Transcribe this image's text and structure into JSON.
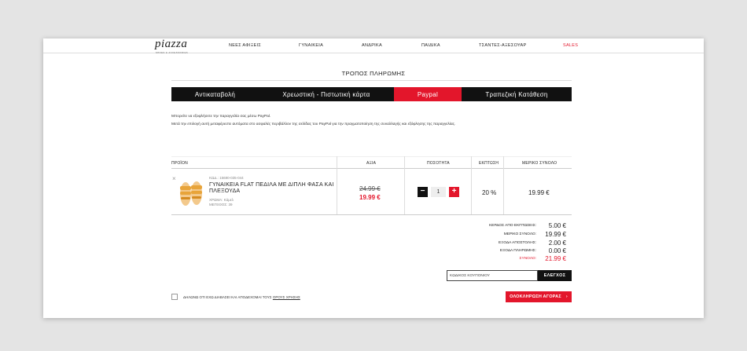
{
  "header": {
    "logo": "piazza",
    "logo_tagline": "SHOES & ACCESSORIES",
    "nav": [
      "ΝΕΕΣ ΑΦΙΞΕΙΣ",
      "ΓΥΝΑΙΚΕΙΑ",
      "ΑΝΔΡΙΚΑ",
      "ΠΑΙΔΙΚΑ",
      "ΤΣΑΝΤΕΣ-ΑΞΕΣΟΥΑΡ",
      "SALES"
    ]
  },
  "page_title": "ΤΡΟΠΟΣ ΠΛΗΡΩΜΗΣ",
  "payment_tabs": [
    {
      "label": "Αντικαταβολή",
      "active": false
    },
    {
      "label": "Χρεωστική - Πιστωτική κάρτα",
      "active": false
    },
    {
      "label": "Paypal",
      "active": true
    },
    {
      "label": "Τραπεζική Κατάθεση",
      "active": false
    }
  ],
  "info": {
    "line1": "Μπορείτε να εξοφλήσετε την παραγγελία σας μέσω PayPal.",
    "line2": "Μετά την επιλογή αυτή μεταφέρεστε αυτόματα στο ασφαλές περιβάλλον της σελίδας του PayPal για την πραγματοποίηση της συναλλαγής και εξόφλησης της παραγγελίας."
  },
  "table": {
    "headers": [
      "ΠΡΟΪΟΝ",
      "ΑΞΙΑ",
      "ΠΟΣΟΤΗΤΑ",
      "ΕΚΠΤΩΣΗ",
      "ΜΕΡΙΚΟ ΣΥΝΟΛΟ"
    ],
    "item": {
      "remove": "×",
      "sku": "ΚΩΔ.: 15690-035-044",
      "name": "ΓΥΝΑΙΚΕΙΑ FLAT ΠΕΔΙΛΑ ΜΕ ΔΙΠΛΗ ΦΑΣΑ ΚΑΙ ΠΛΕΞΟΥΔΑ",
      "color": "ΧΡΩΜΑ: Κάμελ",
      "size": "ΜΕΓΕΘΟΣ: 39",
      "old_price": "24.99 €",
      "new_price": "19.99 €",
      "qty_minus": "−",
      "qty": "1",
      "qty_plus": "+",
      "discount": "20 %",
      "subtotal": "19.99 €"
    }
  },
  "summary": {
    "rows": [
      {
        "label": "ΚΕΡΔΟΣ ΑΠΟ ΕΚΠΤΩΣΕΙΣ:",
        "value": "5.00 €"
      },
      {
        "label": "ΜΕΡΙΚΟ ΣΥΝΟΛΟ:",
        "value": "19.99 €"
      },
      {
        "label": "ΕΞΟΔΑ ΑΠΟΣΤΟΛΗΣ:",
        "value": "2.00 €"
      },
      {
        "label": "ΕΞΟΔΑ ΠΛΗΡΩΜΗΣ:",
        "value": "0.00 €"
      },
      {
        "label": "ΣΥΝΟΛΟ:",
        "value": "21.99 €"
      }
    ]
  },
  "coupon": {
    "placeholder": "ΚΩΔΙΚΟΣ ΚΟΥΠΟΝΙΟΥ",
    "button": "ΕΛΕΓΧΟΣ"
  },
  "terms": {
    "text": "ΔΗΛΩΝΩ ΟΤΙ ΕΧΩ ΔΙΑΒΑΣΕΙ ΚΑΙ ΑΠΟΔΕΧΟΜΑΙ ΤΟΥΣ",
    "link": "ΟΡΟΥΣ ΧΡΗΣΗΣ"
  },
  "checkout": {
    "label": "ΟΛΟΚΛΗΡΩΣΗ ΑΓΟΡΑΣ",
    "arrow": "›"
  },
  "colors": {
    "accent": "#e3162b",
    "dark": "#111111",
    "camel": "#e8a43a"
  }
}
